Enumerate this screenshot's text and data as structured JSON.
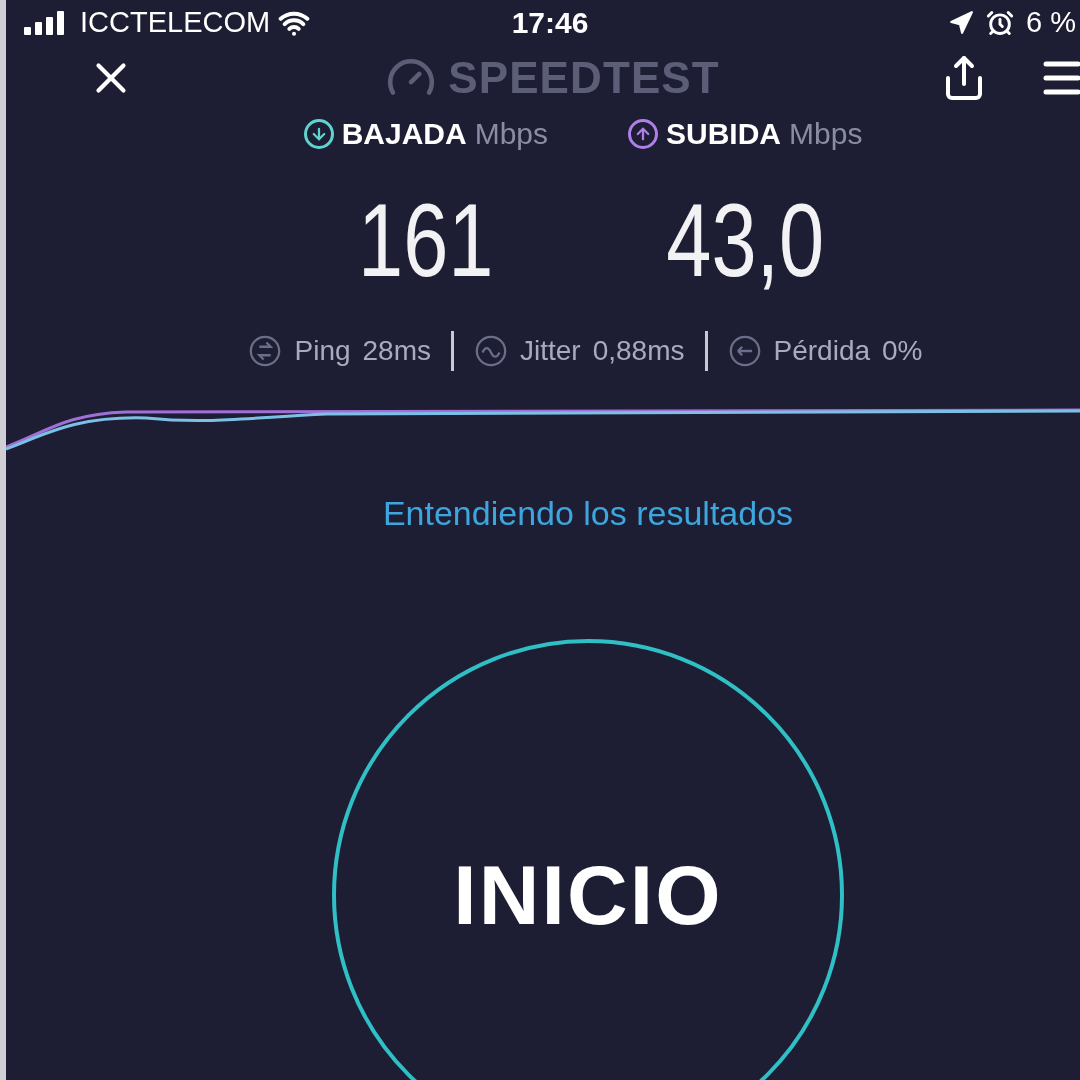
{
  "status_bar": {
    "carrier": "ICCTELECOM",
    "time": "17:46",
    "battery": "6 %"
  },
  "header": {
    "title": "SPEEDTEST"
  },
  "results": [
    {
      "kind": "download",
      "label": "BAJADA",
      "unit": "Mbps",
      "value": "161",
      "color": "#5fd3cf"
    },
    {
      "kind": "upload",
      "label": "SUBIDA",
      "unit": "Mbps",
      "value": "43,0",
      "color": "#b07ee8"
    }
  ],
  "stats": [
    {
      "kind": "ping",
      "label": "Ping",
      "value": "28ms"
    },
    {
      "kind": "jitter",
      "label": "Jitter",
      "value": "0,88ms"
    },
    {
      "kind": "loss",
      "label": "Pérdida",
      "value": "0%"
    }
  ],
  "link": "Entendiendo los resultados",
  "start_button": "INICIO"
}
